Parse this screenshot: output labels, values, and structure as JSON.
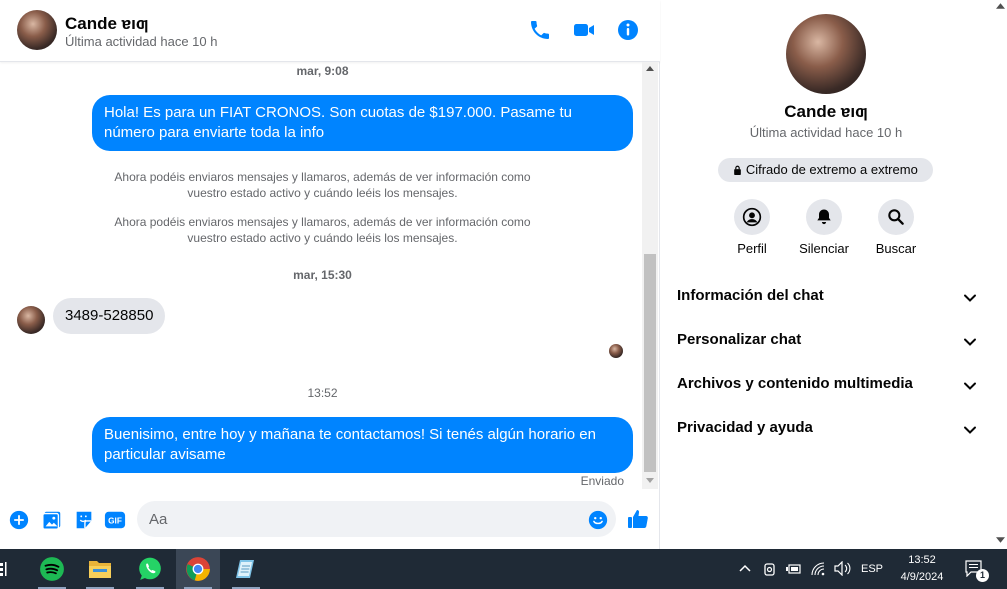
{
  "header": {
    "name": "Cande ɐıƣ",
    "status": "Última actividad hace 10 h"
  },
  "messages": {
    "ts1": "mar, 9:08",
    "out1": "Hola! Es para un FIAT CRONOS. Son cuotas de $197.000. Pasame tu número para enviarte toda la info",
    "sys1": "Ahora podéis enviaros mensajes y llamaros, además de ver información como vuestro estado activo y cuándo leéis los mensajes.",
    "sys2": "Ahora podéis enviaros mensajes y llamaros, además de ver información como vuestro estado activo y cuándo leéis los mensajes.",
    "ts2": "mar, 15:30",
    "in1": "3489-528850",
    "ts3": "13:52",
    "out2": "Buenisimo, entre hoy y mañana te contactamos! Si tenés algún horario en particular avisame",
    "sent_label": "Enviado"
  },
  "composer": {
    "placeholder": "Aa"
  },
  "info": {
    "name": "Cande ɐıƣ",
    "status": "Última actividad hace 10 h",
    "encryption": "Cifrado de extremo a extremo",
    "actions": [
      {
        "label": "Perfil",
        "icon": "profile-icon"
      },
      {
        "label": "Silenciar",
        "icon": "bell-icon"
      },
      {
        "label": "Buscar",
        "icon": "search-icon"
      }
    ],
    "sections": [
      "Información del chat",
      "Personalizar chat",
      "Archivos y contenido multimedia",
      "Privacidad y ayuda"
    ]
  },
  "taskbar": {
    "language": "ESP",
    "time": "13:52",
    "date": "4/9/2024",
    "notification_count": "1"
  },
  "colors": {
    "accent": "#0084ff",
    "bubble_in": "#e4e6eb",
    "taskbar": "#1f2a36"
  }
}
